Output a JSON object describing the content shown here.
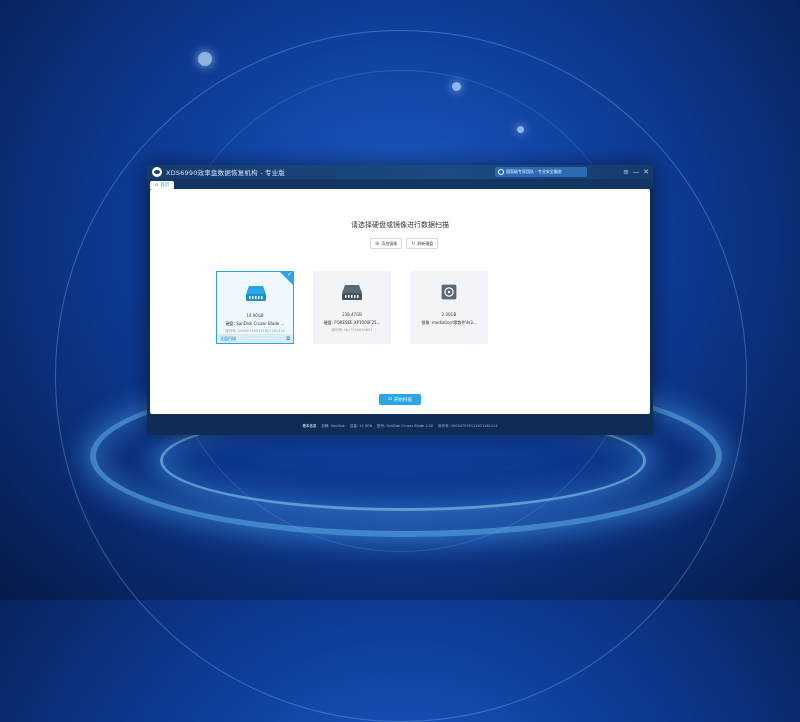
{
  "window": {
    "title": "XDS6990效率盘数据恢复机构 - 专业版",
    "promo_text": "国家级专家团队 · 专业安全服务",
    "controls": [
      "≡",
      "—",
      "✕"
    ]
  },
  "tab": {
    "label": "首页"
  },
  "main": {
    "heading": "请选择硬盘或镜像进行数据扫描",
    "add_image_label": "添加镜像",
    "refresh_label": "刷新硬盘",
    "start_scan_label": "开始扫描"
  },
  "drives": [
    {
      "size": "14.90GB",
      "name": "硬盘:  SanDisk Cruzer Blade ...",
      "serial": "序列号: 200507595111621181414",
      "footer_left": "全盘扫描",
      "icon": "hard-drive-icon",
      "selected": true
    },
    {
      "size": "238.47GB",
      "name": "硬盘:  FORESEE XP1000F25...",
      "serial": "序列号: NJ17550620621",
      "icon": "hard-drive-icon",
      "selected": false
    },
    {
      "size": "2.00GB",
      "name": "镜像:  mediation\\零散件\\fs3...",
      "serial": "",
      "icon": "disk-image-icon",
      "selected": false
    }
  ],
  "status": {
    "heading": "基本信息",
    "vendor": "品牌:  SanDisk",
    "capacity": "容量:  14.9GB",
    "model": "型号:  SanDisk Cruzer Blade 1.00",
    "serial": "序列号:  200507595111621181414"
  },
  "colors": {
    "accent": "#2aa6e6",
    "title_bar": "#163b6b"
  }
}
